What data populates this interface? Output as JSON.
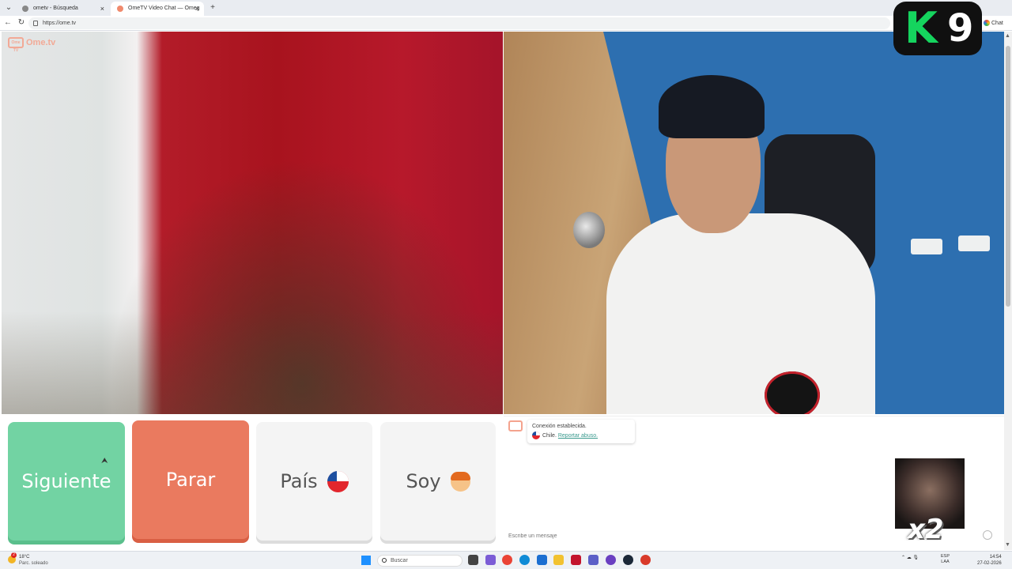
{
  "browser": {
    "tabs": [
      {
        "title": "ometv - Búsqueda"
      },
      {
        "title": "OmeTV Video Chat — Omeg"
      }
    ],
    "new_tab_symbol": "+",
    "close_symbol": "×",
    "url": "https://ome.tv",
    "chat_label": "Chat"
  },
  "app": {
    "logo_text": "Ome.tv",
    "logo_box_text": "Ome TV"
  },
  "overlay": {
    "k9_letter": "K",
    "k9_number": "9",
    "multiplier": "x2"
  },
  "controls": {
    "next_label": "Siguiente",
    "stop_label": "Parar",
    "country_label": "País",
    "country_flag_icon": "chile-flag-icon",
    "gender_label": "Soy",
    "gender_icon": "boy-emoji-icon"
  },
  "chat": {
    "status_text": "Conexión establecida.",
    "country_text": "Chile.",
    "report_link": "Reportar abuso.",
    "input_placeholder": "Escribe un mensaje"
  },
  "taskbar": {
    "weather_temp": "18°C",
    "weather_desc": "Parc. soleado",
    "weather_badge": "2",
    "search_placeholder": "Buscar",
    "language_line1": "ESP",
    "language_line2": "LAA",
    "time": "14:54",
    "date": "27-02-2026"
  },
  "colors": {
    "next_button": "#72d3a3",
    "stop_button": "#ea7a5f",
    "neutral_button": "#f4f4f4",
    "link_teal": "#3a9a8e",
    "k9_green": "#15d45e"
  }
}
